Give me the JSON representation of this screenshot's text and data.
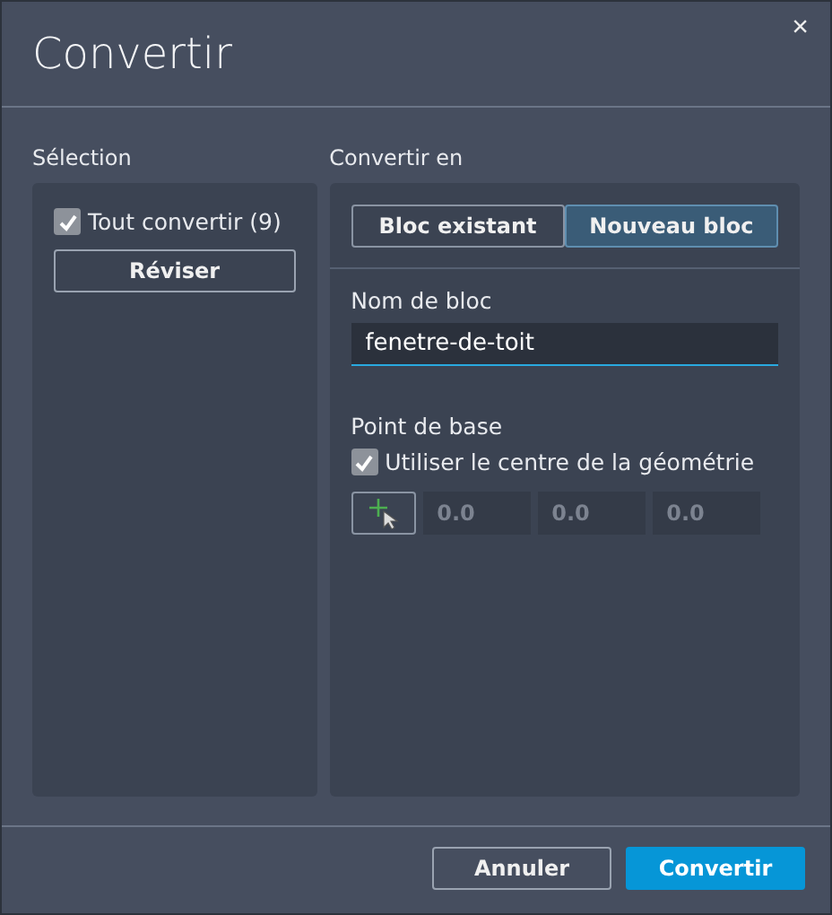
{
  "window": {
    "title": "Convertir",
    "close": "×"
  },
  "selection": {
    "heading": "Sélection",
    "convert_all": {
      "label": "Tout convertir (9)",
      "checked": true
    },
    "review_button": "Réviser"
  },
  "convert_to": {
    "heading": "Convertir en",
    "tabs": [
      {
        "label": "Bloc existant",
        "selected": false
      },
      {
        "label": "Nouveau bloc",
        "selected": true
      }
    ],
    "block_name": {
      "label": "Nom de bloc",
      "value": "fenetre-de-toit"
    },
    "base_point": {
      "label": "Point de base",
      "use_center": {
        "label": "Utiliser le centre de la géométrie",
        "checked": true
      },
      "coordinates": [
        {
          "value": "0.0",
          "disabled": true
        },
        {
          "value": "0.0",
          "disabled": true
        },
        {
          "value": "0.0",
          "disabled": true
        }
      ]
    }
  },
  "buttons": [
    {
      "label": "Annuler",
      "kind": "secondary"
    },
    {
      "label": "Convertir",
      "kind": "primary"
    }
  ]
}
